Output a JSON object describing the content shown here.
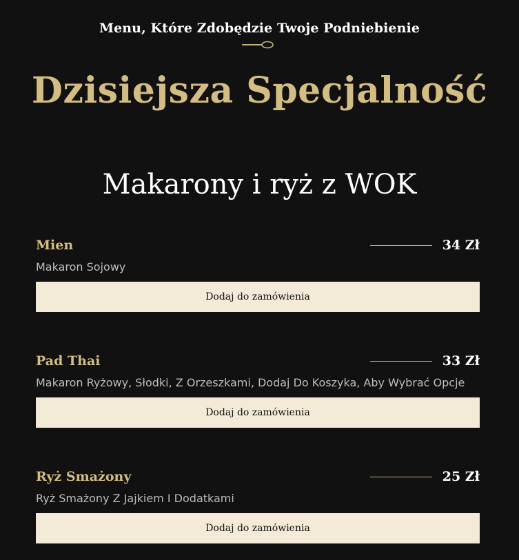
{
  "header": {
    "tagline": "Menu, Które Zdobędzie Twoje Podniebienie",
    "divider_icon": "spoon-icon",
    "title": "Dzisiejsza Specjalność"
  },
  "section": {
    "title": "Makarony i ryż z WOK"
  },
  "menu_items": [
    {
      "name": "Mien",
      "price": "34 Zł",
      "description": "Makaron Sojowy",
      "button_label": "Dodaj do zamówienia"
    },
    {
      "name": "Pad Thai",
      "price": "33 Zł",
      "description": "Makaron Ryżowy, Słodki, Z Orzeszkami, Dodaj Do Koszyka, Aby Wybrać Opcje",
      "button_label": "Dodaj do zamówienia"
    },
    {
      "name": "Ryż Smażony",
      "price": "25 Zł",
      "description": "Ryż Smażony Z Jajkiem I Dodatkami",
      "button_label": "Dodaj do zamówienia"
    }
  ],
  "colors": {
    "background": "#111111",
    "accent_gold": "#d4bd82",
    "button_background": "#f3ebd8",
    "text_white": "#ffffff",
    "text_muted": "#bdbdbd"
  }
}
